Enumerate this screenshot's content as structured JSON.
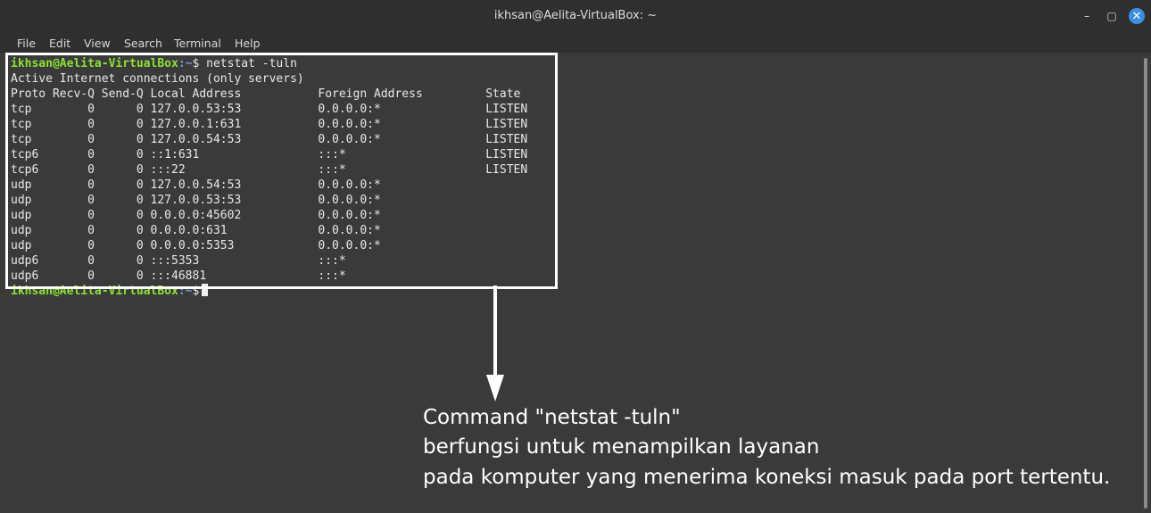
{
  "window": {
    "title": "ikhsan@Aelita-VirtualBox: ~",
    "minimize_glyph": "–",
    "maximize_glyph": "▢",
    "close_glyph": "✕"
  },
  "menu": [
    "File",
    "Edit",
    "View",
    "Search",
    "Terminal",
    "Help"
  ],
  "terminal": {
    "prompt_user": "ikhsan@Aelita-VirtualBox",
    "prompt_path": ":~",
    "prompt_symbol": "$",
    "command": " netstat -tuln",
    "output": [
      "Active Internet connections (only servers)",
      "Proto Recv-Q Send-Q Local Address           Foreign Address         State",
      "tcp        0      0 127.0.0.53:53           0.0.0.0:*               LISTEN",
      "tcp        0      0 127.0.0.1:631           0.0.0.0:*               LISTEN",
      "tcp        0      0 127.0.0.54:53           0.0.0.0:*               LISTEN",
      "tcp6       0      0 ::1:631                 :::*                    LISTEN",
      "tcp6       0      0 :::22                   :::*                    LISTEN",
      "udp        0      0 127.0.0.54:53           0.0.0.0:*",
      "udp        0      0 127.0.0.53:53           0.0.0.0:*",
      "udp        0      0 0.0.0.0:45602           0.0.0.0:*",
      "udp        0      0 0.0.0.0:631             0.0.0.0:*",
      "udp        0      0 0.0.0.0:5353            0.0.0.0:*",
      "udp6       0      0 :::5353                 :::*",
      "udp6       0      0 :::46881                :::*"
    ]
  },
  "annotation": {
    "lines": [
      "Command \"netstat -tuln\"",
      "berfungsi untuk menampilkan layanan",
      "pada komputer yang menerima koneksi masuk pada port tertentu."
    ]
  }
}
